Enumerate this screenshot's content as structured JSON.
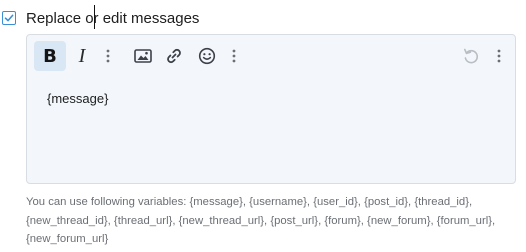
{
  "option": {
    "label": "Replace or edit messages",
    "checked": true
  },
  "editor": {
    "toolbar": {
      "bold_glyph": "B",
      "italic_glyph": "I",
      "buttons": [
        "bold-icon",
        "italic-icon",
        "more-vertical-icon",
        "image-icon",
        "link-icon",
        "emoji-icon",
        "more-vertical-icon",
        "undo-icon",
        "more-vertical-icon"
      ]
    },
    "content": "{message}"
  },
  "help_text": "You can use following variables: {message}, {username}, {user_id}, {post_id}, {thread_id}, {new_thread_id}, {thread_url}, {new_thread_url}, {post_url}, {forum}, {new_forum}, {forum_url}, {new_forum_url}",
  "colors": {
    "accent": "#3b8fd6",
    "editor_bg": "#f3f7fc",
    "active_button_bg": "#d9e6f4"
  }
}
